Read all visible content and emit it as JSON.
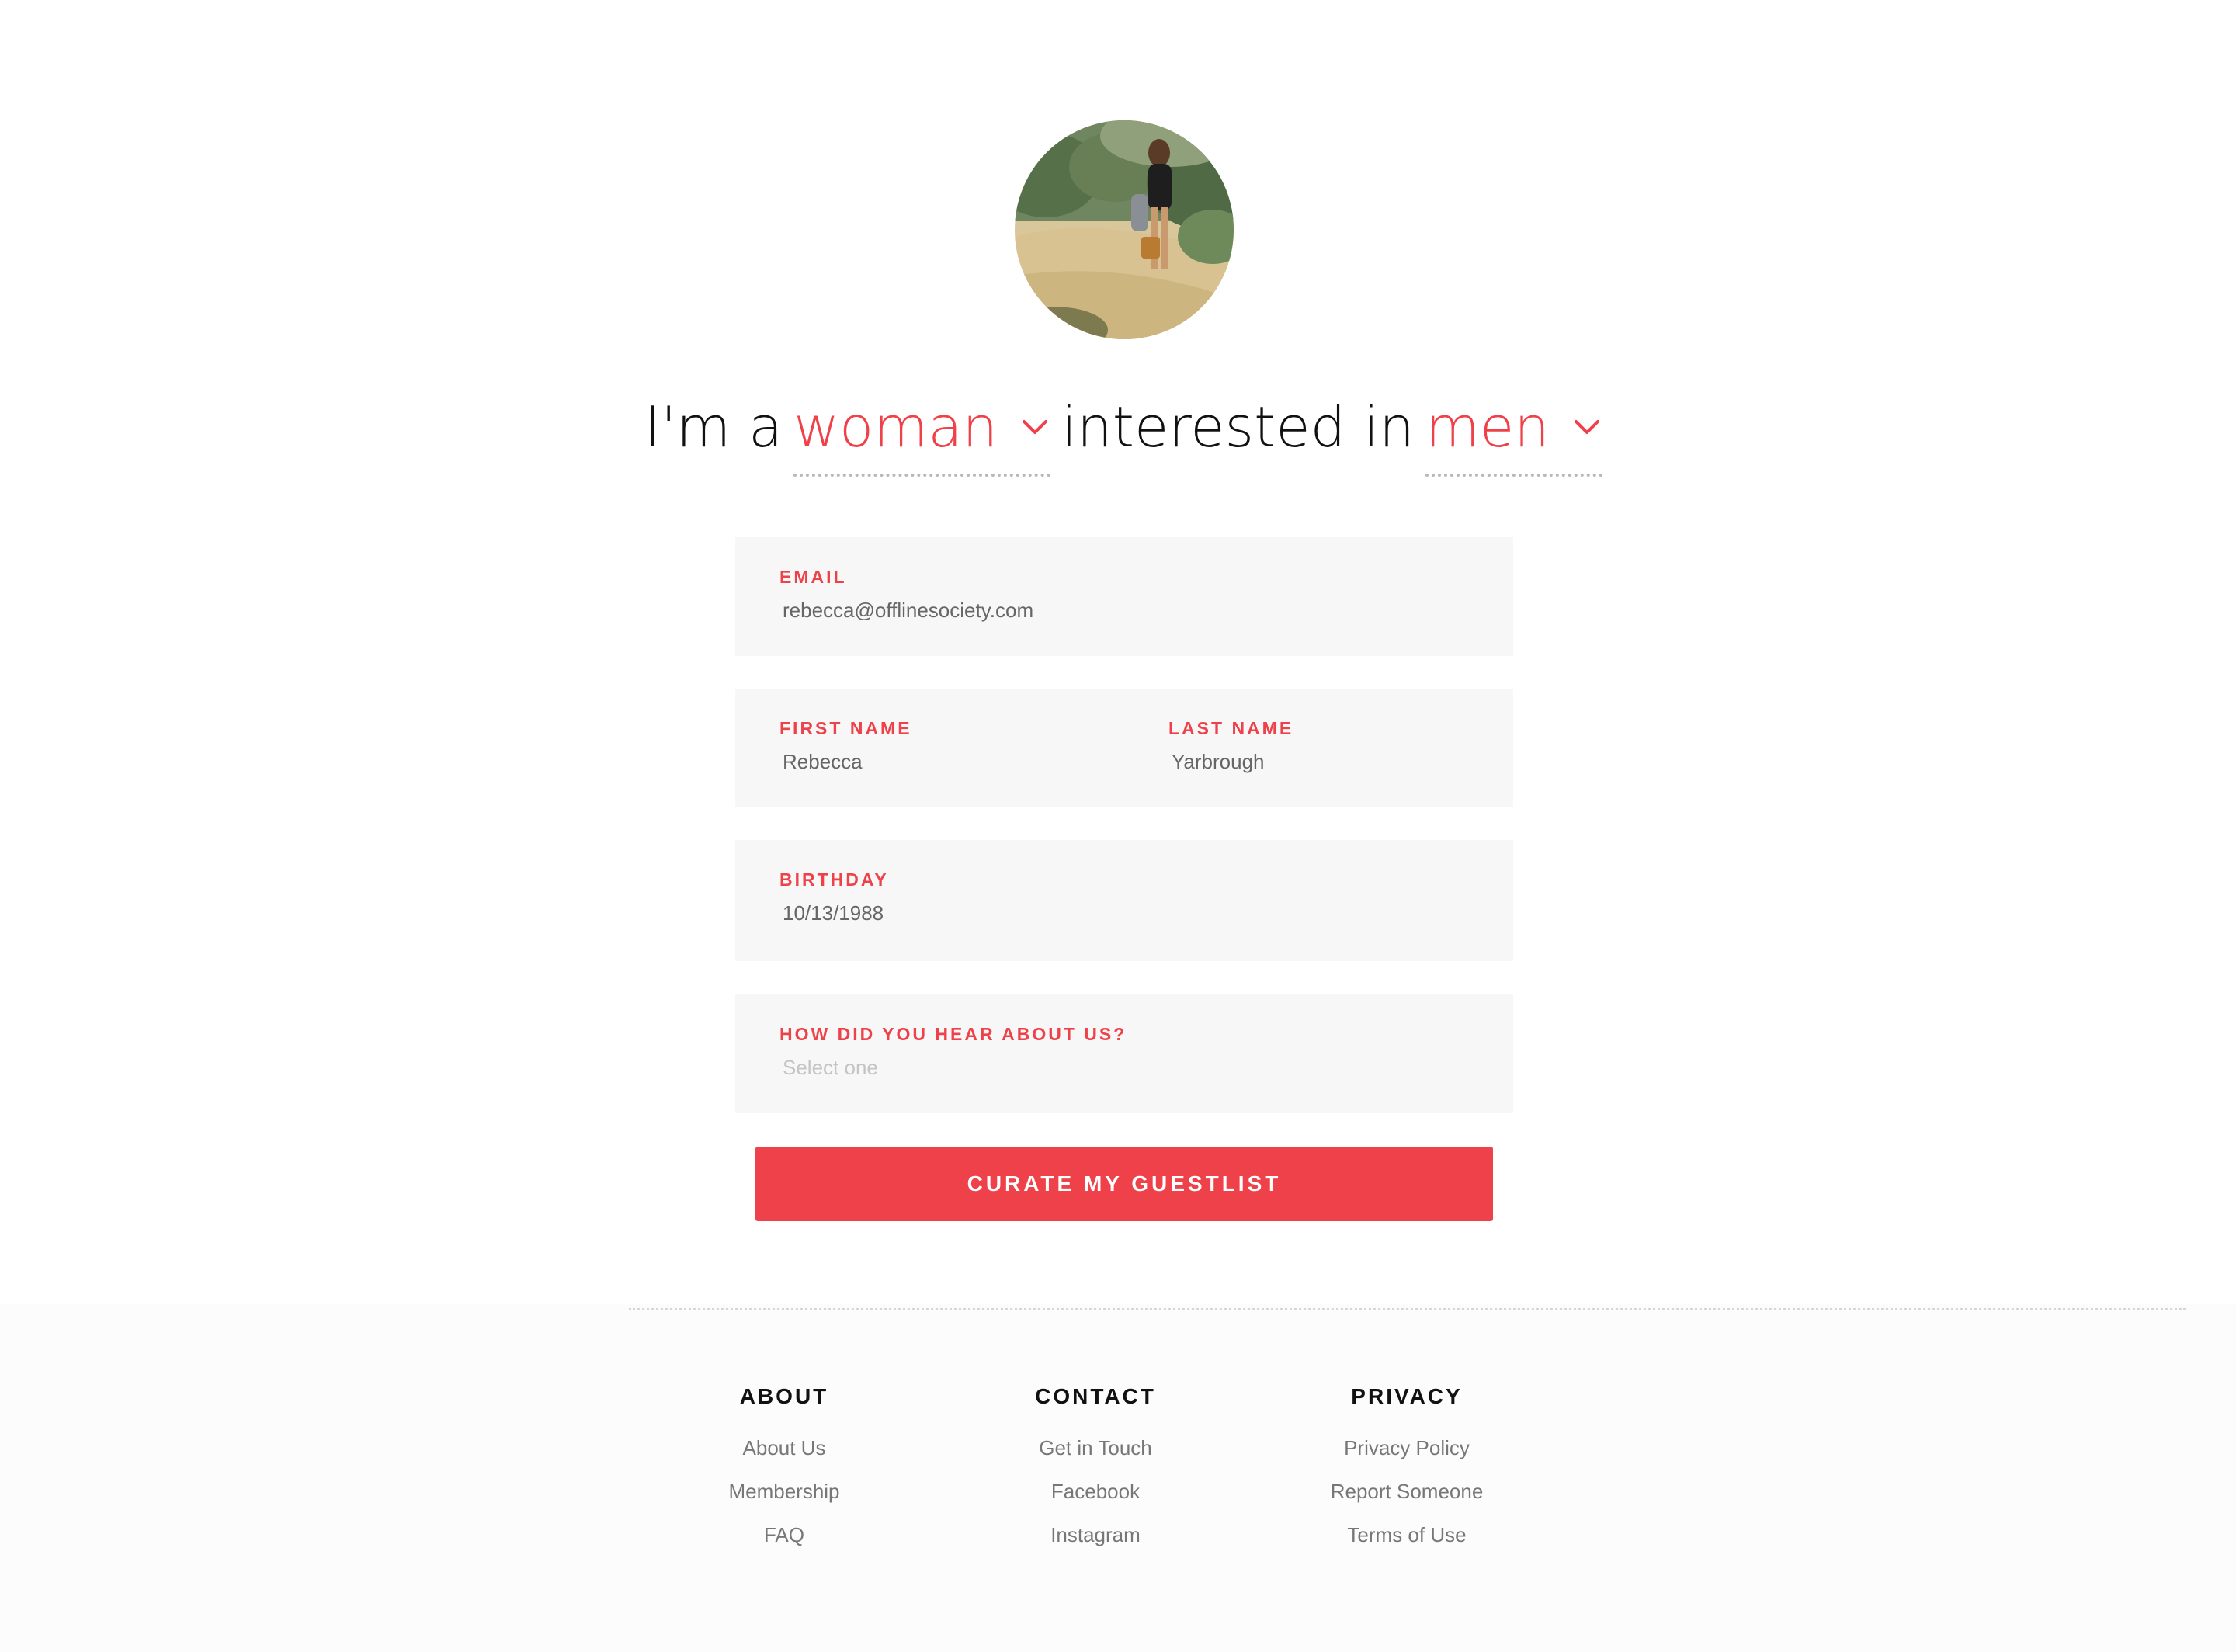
{
  "headline": {
    "prefix": "I'm a",
    "gender_value": "woman",
    "middle": "interested in",
    "interest_value": "men"
  },
  "form": {
    "email": {
      "label": "EMAIL",
      "value": "rebecca@offlinesociety.com"
    },
    "first_name": {
      "label": "FIRST NAME",
      "value": "Rebecca"
    },
    "last_name": {
      "label": "LAST NAME",
      "value": "Yarbrough"
    },
    "birthday": {
      "label": "BIRTHDAY",
      "value": "10/13/1988"
    },
    "source": {
      "label": "HOW DID YOU HEAR ABOUT US?",
      "placeholder": "Select one"
    },
    "submit_label": "CURATE MY GUESTLIST"
  },
  "footer": {
    "about": {
      "title": "ABOUT",
      "links": [
        "About Us",
        "Membership",
        "FAQ"
      ]
    },
    "contact": {
      "title": "CONTACT",
      "links": [
        "Get in Touch",
        "Facebook",
        "Instagram"
      ]
    },
    "privacy": {
      "title": "PRIVACY",
      "links": [
        "Privacy Policy",
        "Report Someone",
        "Terms of Use"
      ]
    }
  },
  "colors": {
    "accent": "#ef414a",
    "field_bg": "#f7f7f7",
    "text_muted": "#666666"
  },
  "icons": {
    "dropdown": "chevron-down-icon"
  }
}
